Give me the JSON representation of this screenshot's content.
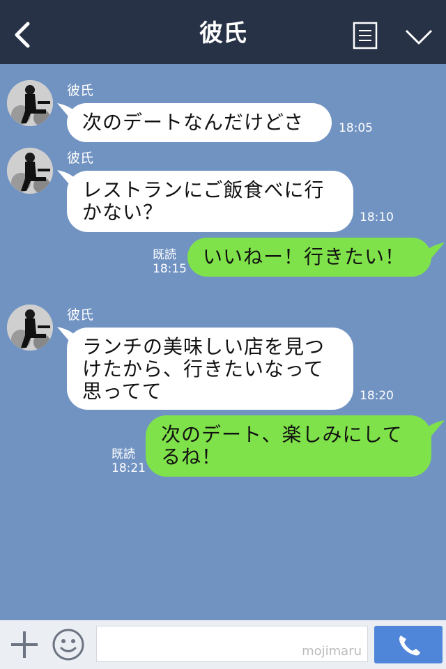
{
  "header": {
    "title": "彼氏"
  },
  "messages": [
    {
      "sender": "彼氏",
      "text": "次のデートなんだけどさ",
      "time": "18:05"
    },
    {
      "sender": "彼氏",
      "line1": "レストランにご飯食べに行",
      "line2": "かない？",
      "time": "18:10"
    },
    {
      "read_label": "既読",
      "time": "18:15",
      "text": "いいねー！行きたい！"
    },
    {
      "sender": "彼氏",
      "line1": "ランチの美味しい店を見つ",
      "line2": "けたから、行きたいなって",
      "line3": "思ってて",
      "time": "18:20"
    },
    {
      "read_label": "既読",
      "time": "18:21",
      "line1": "次のデート、楽しみにして",
      "line2": "るね！"
    }
  ],
  "footer": {
    "watermark": "mojimaru"
  },
  "colors": {
    "header": "#273247",
    "background": "#7193c2",
    "incoming": "#ffffff",
    "outgoing": "#7fe24a",
    "send": "#4f86d9"
  }
}
